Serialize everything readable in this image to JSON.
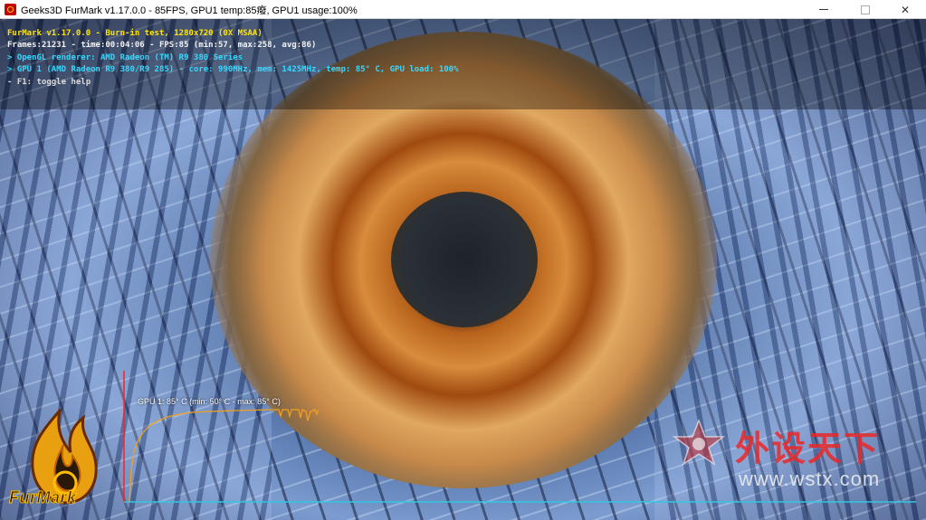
{
  "window": {
    "title": "Geeks3D FurMark v1.17.0.0 - 85FPS, GPU1 temp:85癈, GPU1 usage:100%",
    "icon": "furmark-app-icon",
    "controls": [
      "minimize-icon",
      "maximize-icon",
      "close-icon"
    ]
  },
  "hud": {
    "line1": "FurMark v1.17.0.0 - Burn-in test, 1280x720 (0X MSAA)",
    "line2": "Frames:21231 - time:00:04:06 - FPS:85 (min:57, max:258, avg:86)",
    "line3": "> OpenGL renderer: AMD Radeon (TM) R9 380 Series",
    "line4": "> GPU 1 (AMD Radeon R9 380/R9 285) - core: 990MHz, mem: 1425MHz, temp: 85° C, GPU load: 100%",
    "line5": "- F1: toggle help"
  },
  "temp_graph": {
    "label": "GPU 1: 85° C (min: 50° C - max: 85° C)",
    "current": 85,
    "min": 50,
    "max": 85,
    "line_color": "#f0a020"
  },
  "logo": {
    "text": "FurMark"
  },
  "watermark": {
    "chinese": "外设天下",
    "url": "www.wstx.com",
    "color": "#eb2828"
  },
  "colors": {
    "hud_yellow": "#ffe400",
    "hud_cyan": "#36d8ff",
    "graph_axis": "#ff2020",
    "graph_baseline": "#30c8e0"
  }
}
